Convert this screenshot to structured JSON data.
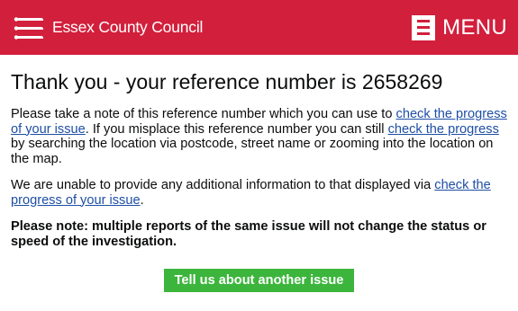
{
  "header": {
    "brand": "Essex County Council",
    "menu_label": "MENU",
    "colors": {
      "brand_red": "#d21f3c"
    },
    "logo_icon": "essex-seaxes-icon",
    "menu_icon": "hamburger-icon"
  },
  "main": {
    "title": "Thank you - your reference number is 2658269",
    "para1": {
      "t1": "Please take a note of this reference number which you can use to ",
      "link1": "check the progress of your issue",
      "t2": ". If you misplace this reference number you can still ",
      "link2": "check the progress",
      "t3": " by searching the location via postcode, street name or zooming into the location on the map."
    },
    "para2": {
      "t1": "We are unable to provide any additional information to that displayed via ",
      "link": "check the progress of your issue",
      "t2": "."
    },
    "note": "Please note: multiple reports of the same issue will not change the status or speed of the investigation.",
    "button_label": "Tell us about another issue",
    "colors": {
      "link": "#1d4ea5",
      "button": "#3cb53c"
    }
  }
}
